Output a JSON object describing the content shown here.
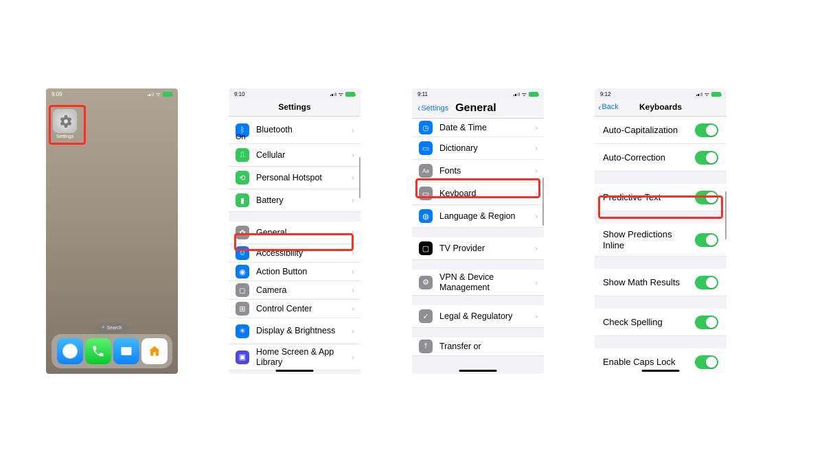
{
  "panel1": {
    "time": "9:09",
    "settings_label": "Settings",
    "search_label": "Search"
  },
  "panel2": {
    "time": "9:10",
    "title": "Settings",
    "bluetooth": "Bluetooth",
    "bluetooth_state": "On",
    "cellular": "Cellular",
    "hotspot": "Personal Hotspot",
    "battery": "Battery",
    "general": "General",
    "accessibility": "Accessibility",
    "action_button": "Action Button",
    "camera": "Camera",
    "control_center": "Control Center",
    "display": "Display & Brightness",
    "home_screen": "Home Screen & App Library"
  },
  "panel3": {
    "time": "9:11",
    "back": "Settings",
    "title": "General",
    "date_time": "Date & Time",
    "dictionary": "Dictionary",
    "fonts": "Fonts",
    "keyboard": "Keyboard",
    "language": "Language & Region",
    "tv": "TV Provider",
    "vpn": "VPN & Device Management",
    "legal": "Legal & Regulatory",
    "transfer": "Transfer or"
  },
  "panel4": {
    "time": "9:12",
    "back": "Back",
    "title": "Keyboards",
    "items": [
      "Auto-Capitalization",
      "Auto-Correction",
      "Predictive Text",
      "Show Predictions Inline",
      "Show Math Results",
      "Check Spelling",
      "Enable Caps Lock"
    ]
  }
}
